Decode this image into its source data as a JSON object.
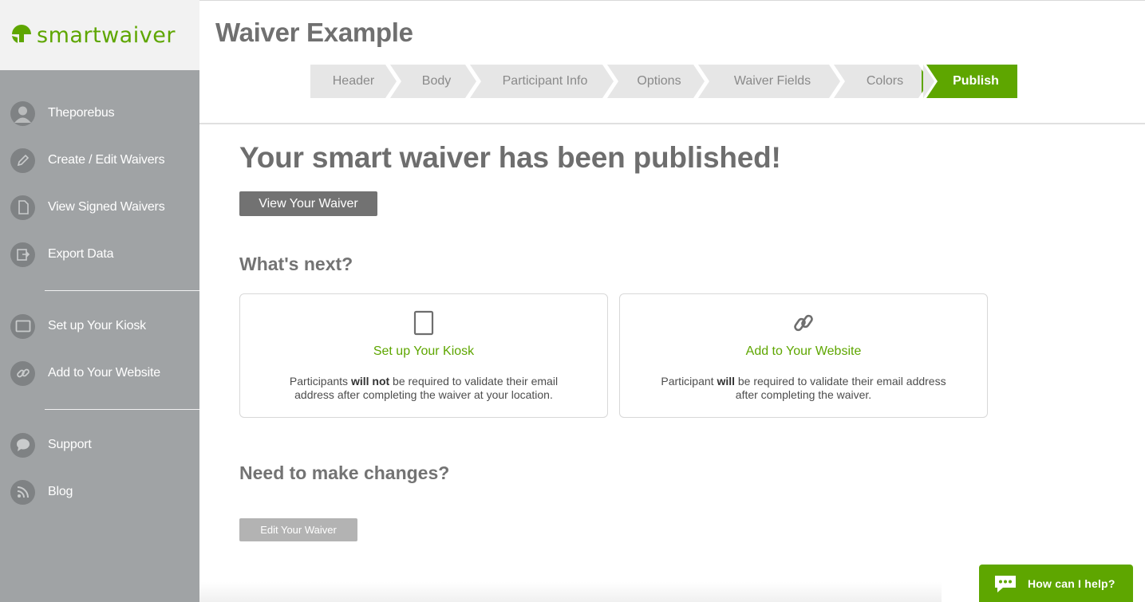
{
  "brand": {
    "logo_text": "smartwaiver",
    "accent_color": "#5ea600"
  },
  "sidebar": {
    "items": [
      {
        "label": "Theporebus",
        "icon": "user-icon"
      },
      {
        "label": "Create / Edit Waivers",
        "icon": "pencil-icon"
      },
      {
        "label": "View Signed Waivers",
        "icon": "document-icon"
      },
      {
        "label": "Export Data",
        "icon": "export-icon"
      },
      {
        "label": "Set up Your Kiosk",
        "icon": "tablet-icon"
      },
      {
        "label": "Add to Your Website",
        "icon": "link-icon"
      },
      {
        "label": "Support",
        "icon": "chat-icon"
      },
      {
        "label": "Blog",
        "icon": "rss-icon"
      }
    ]
  },
  "header": {
    "title": "Waiver Example",
    "steps": [
      {
        "label": "Header"
      },
      {
        "label": "Body"
      },
      {
        "label": "Participant Info"
      },
      {
        "label": "Options"
      },
      {
        "label": "Waiver Fields"
      },
      {
        "label": "Colors"
      },
      {
        "label": "Publish",
        "active": true
      }
    ]
  },
  "main": {
    "headline": "Your smart waiver has been published!",
    "view_button": "View Your Waiver",
    "whats_next_title": "What's next?",
    "cards": [
      {
        "title": "Set up Your Kiosk",
        "icon": "tablet-icon",
        "desc_pre": "Participants ",
        "desc_bold": "will not",
        "desc_post": " be required to validate their email address after completing the waiver at your location."
      },
      {
        "title": "Add to Your Website",
        "icon": "link-icon",
        "desc_pre": "Participant ",
        "desc_bold": "will",
        "desc_post": " be required to validate their email address after completing the waiver."
      }
    ],
    "changes_title": "Need to make changes?",
    "edit_button": "Edit Your Waiver"
  },
  "help_widget": {
    "label": "How can I help?",
    "icon": "chat-bubble-icon"
  }
}
